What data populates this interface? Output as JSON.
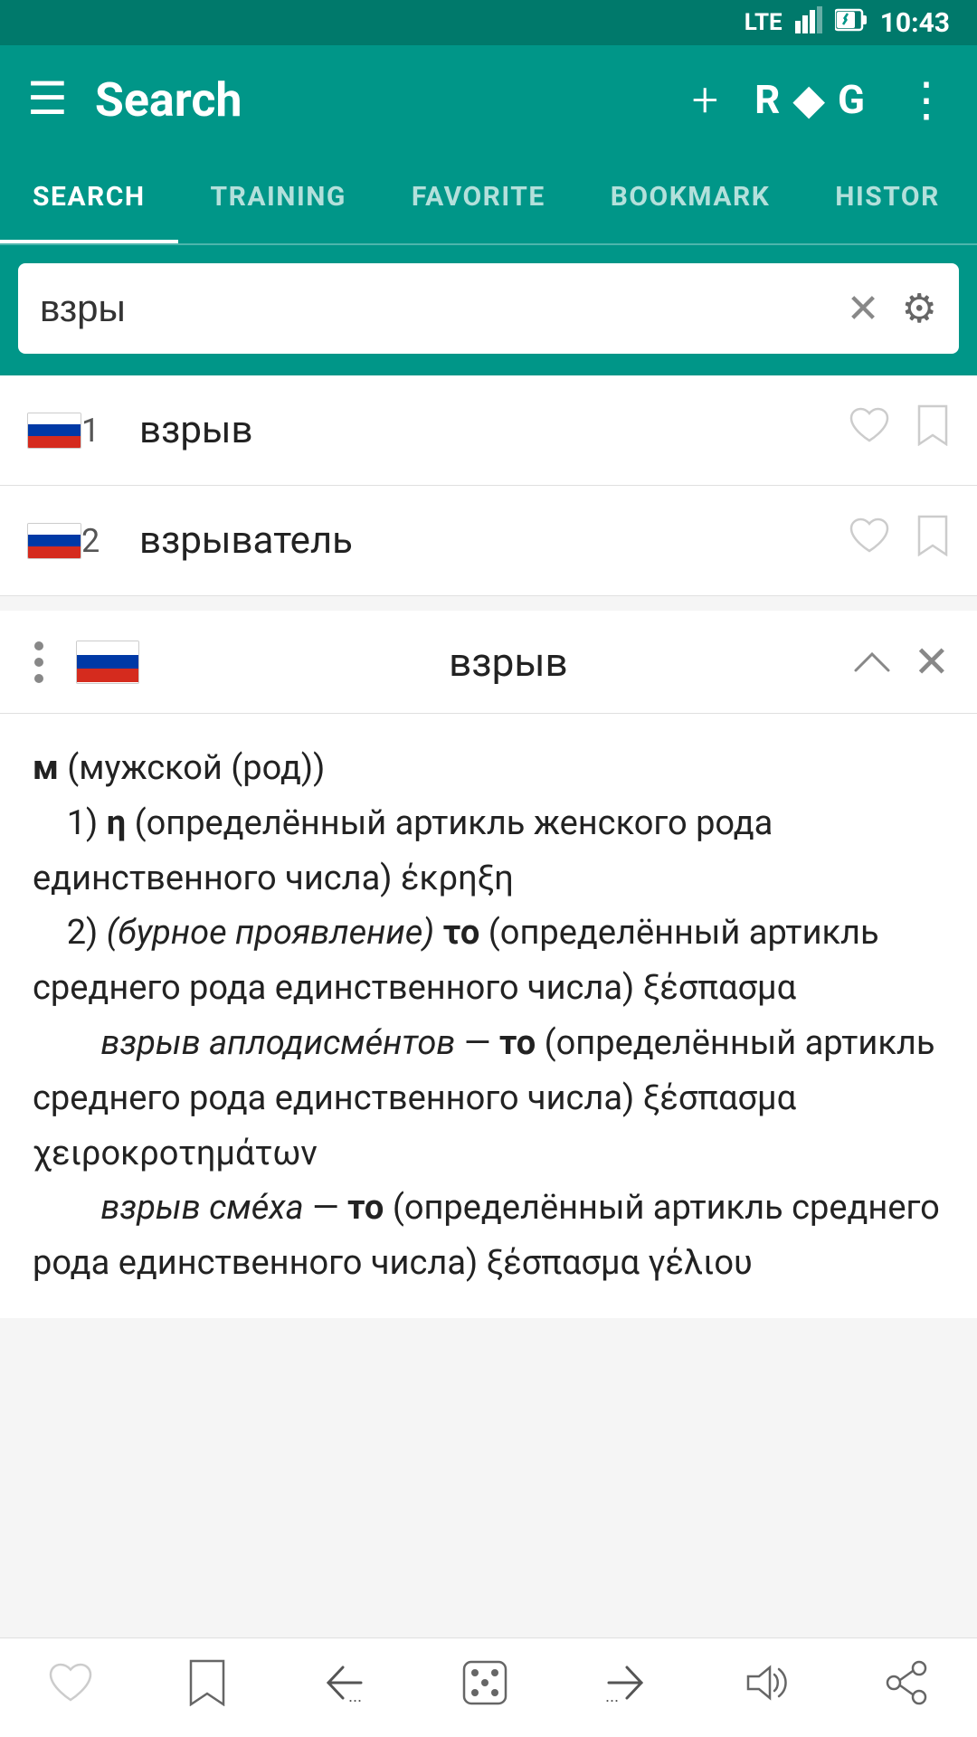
{
  "statusBar": {
    "time": "10:43",
    "icons": [
      "LTE",
      "battery"
    ]
  },
  "appBar": {
    "title": "Search",
    "actions": {
      "add": "+",
      "rdg": "R ◆ G",
      "more": "⋮"
    }
  },
  "tabs": [
    {
      "id": "search",
      "label": "SEARCH",
      "active": true
    },
    {
      "id": "training",
      "label": "TRAINING",
      "active": false
    },
    {
      "id": "favorite",
      "label": "FAVORITE",
      "active": false
    },
    {
      "id": "bookmark",
      "label": "BOOKMARK",
      "active": false
    },
    {
      "id": "history",
      "label": "HISTOR",
      "active": false
    }
  ],
  "search": {
    "query": "взры",
    "clearButton": "✕",
    "settingsButton": "⚙"
  },
  "results": [
    {
      "number": "1",
      "word": "взрыв"
    },
    {
      "number": "2",
      "word": "взрыватель"
    }
  ],
  "detail": {
    "word": "взрыв",
    "definition": "м (мужской (род))\n    1) η (определённый артикль женского рода единственного числа) έκρηξη\n    2) (бурное проявление) το (определённый артикль среднего рода единственного числа) ξέσπασμα\n        взрыв аплодисмéнтов — το (определённый артикль среднего рода единственного числа) ξέσπασμα χειροκροτημάτων\n        взрыв смéха — το (определённый артикль среднего рода единственного числа) ξέσπασμα γέλιου"
  },
  "bottomBar": {
    "heart": "♡",
    "bookmark": "🔖",
    "back": "←",
    "dice": "🎲",
    "forward": "→",
    "volume": "🔊",
    "share": "⬤"
  }
}
